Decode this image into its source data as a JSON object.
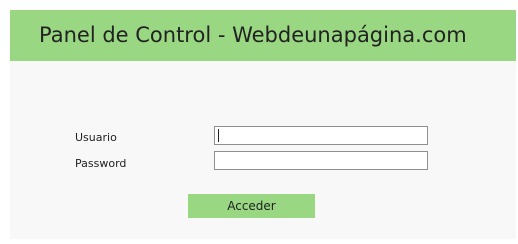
{
  "app": {
    "title": "Panel de Control - Webdeunapágina.com"
  },
  "form": {
    "usuario_label": "Usuario",
    "usuario_value": "",
    "password_label": "Password",
    "password_value": "",
    "submit_label": "Acceder"
  },
  "colors": {
    "header_bg": "#99d782",
    "button_bg": "#99d782",
    "panel_bg": "#f8f8f8",
    "text": "#222222",
    "field_border": "#8f8f8f"
  }
}
